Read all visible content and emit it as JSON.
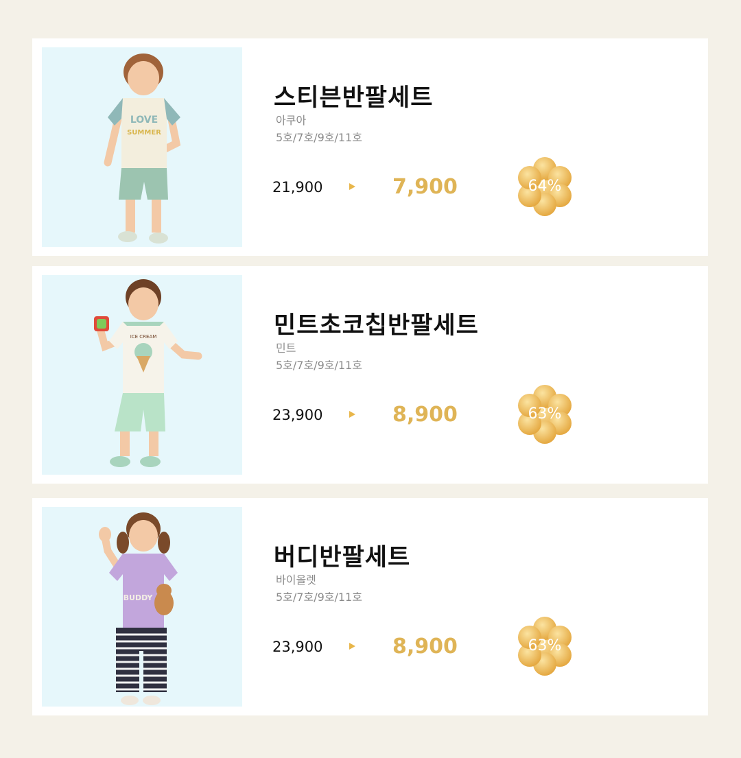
{
  "products": [
    {
      "name": "스티븐반팔세트",
      "color": "아쿠아",
      "sizes": "5호/7호/9호/11호",
      "original_price": "21,900",
      "sale_price": "7,900",
      "discount": "64%",
      "photo_print_text": "LOVE SUMMER"
    },
    {
      "name": "민트초코칩반팔세트",
      "color": "민트",
      "sizes": "5호/7호/9호/11호",
      "original_price": "23,900",
      "sale_price": "8,900",
      "discount": "63%",
      "photo_print_text": "ICE CREAM"
    },
    {
      "name": "버디반팔세트",
      "color": "바이올렛",
      "sizes": "5호/7호/9호/11호",
      "original_price": "23,900",
      "sale_price": "8,900",
      "discount": "63%",
      "photo_print_text": "BUDDY"
    }
  ],
  "colors": {
    "page_bg": "#f4f1e8",
    "photo_bg": "#e6f7fb",
    "sale_price": "#dfb456",
    "badge_light": "#f8d98a",
    "badge_dark": "#e6a93c",
    "arrow": "#e8b64a"
  }
}
